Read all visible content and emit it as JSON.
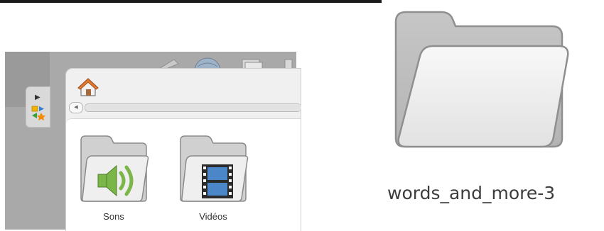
{
  "explorer": {
    "home_icon": "home-icon",
    "folders": [
      {
        "label": "Sons",
        "icon": "speaker-icon"
      },
      {
        "label": "Vidéos",
        "icon": "film-icon"
      }
    ]
  },
  "preview": {
    "folder_name": "words_and_more-3",
    "icon": "folder-icon"
  },
  "colors": {
    "home_roof": "#e07a2e",
    "speaker_green": "#7ab648",
    "film_blue": "#4a86c8"
  }
}
